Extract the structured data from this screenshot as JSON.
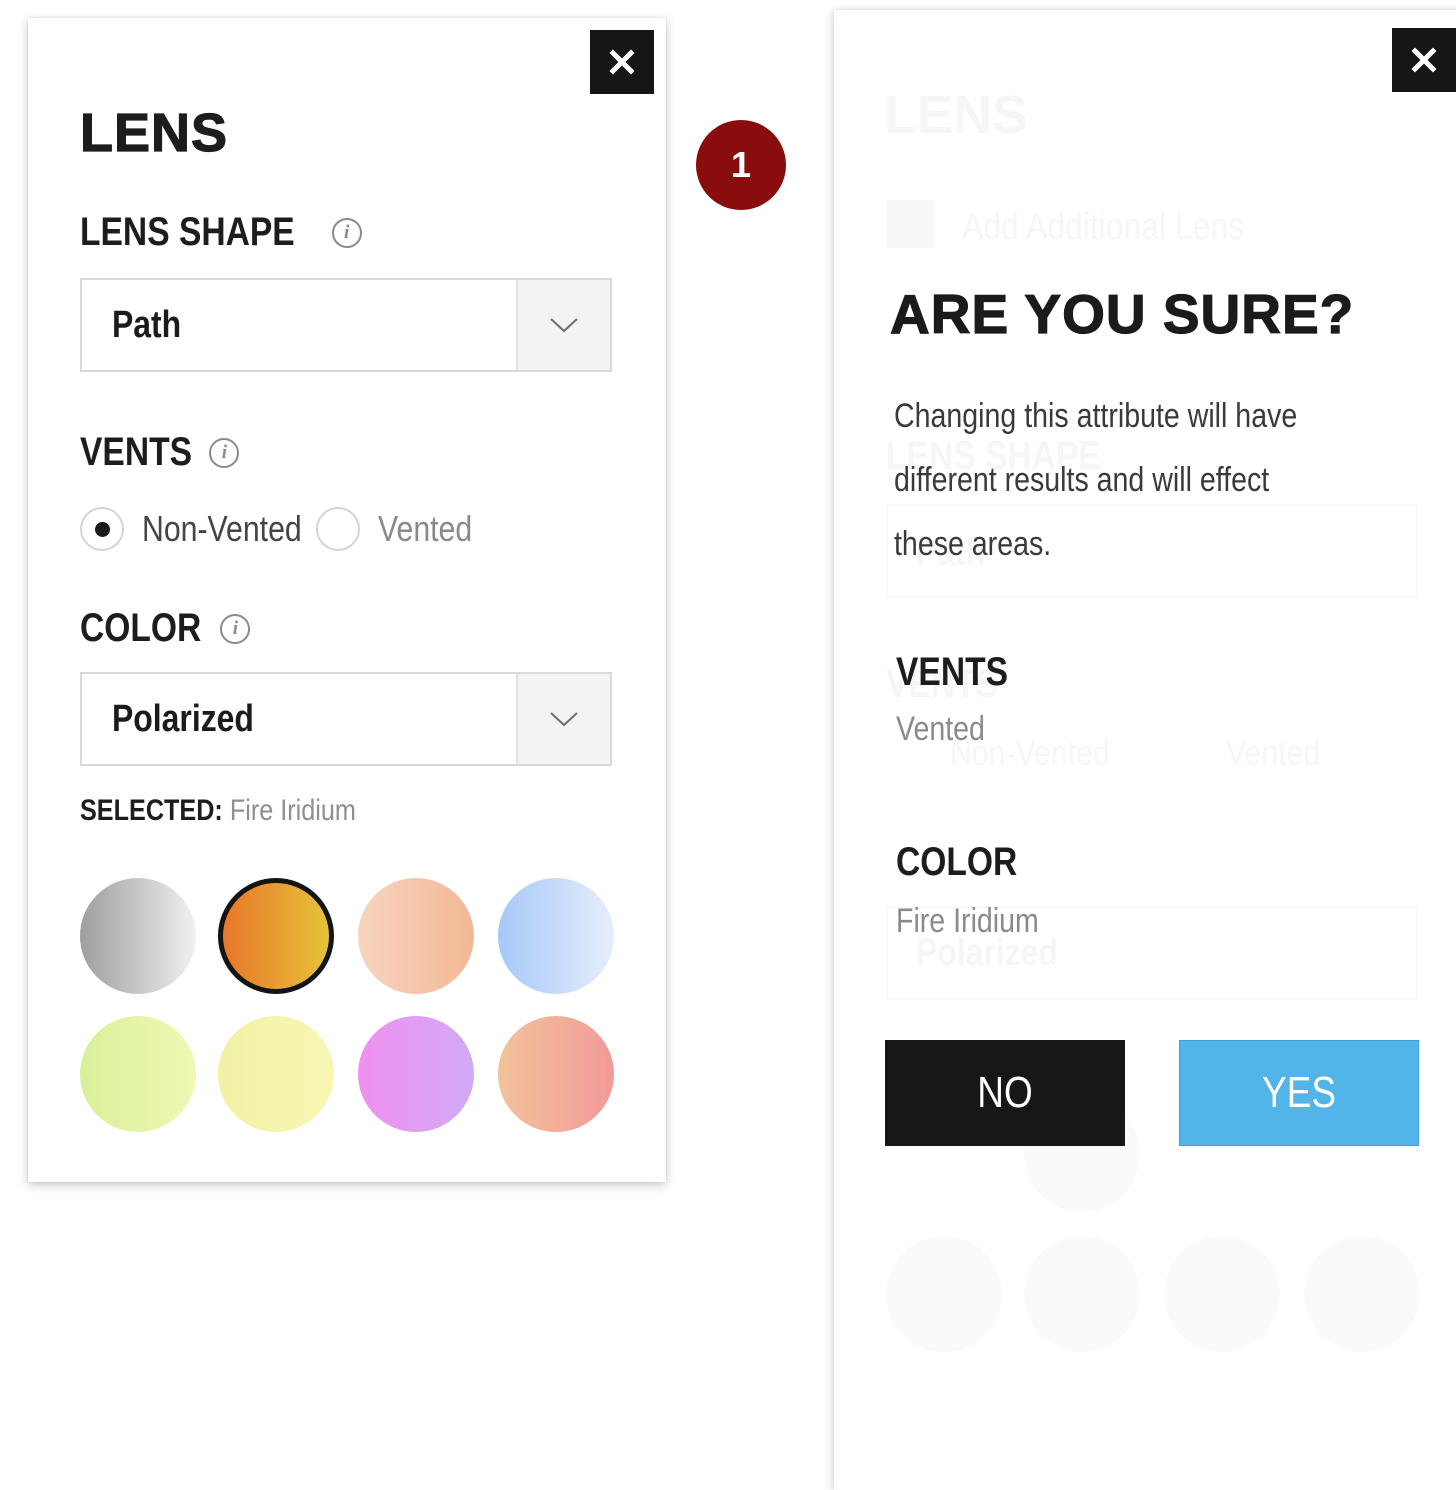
{
  "lens_panel": {
    "title": "LENS",
    "lens_shape": {
      "label": "LENS SHAPE",
      "info_glyph": "i",
      "selected_value": "Path"
    },
    "vents": {
      "label": "VENTS",
      "info_glyph": "i",
      "options": [
        {
          "label": "Non-Vented",
          "checked": true
        },
        {
          "label": "Vented",
          "checked": false
        }
      ]
    },
    "color": {
      "label": "COLOR",
      "info_glyph": "i",
      "selected_value": "Polarized"
    },
    "selected": {
      "key": "SELECTED:",
      "value": "Fire Iridium"
    },
    "swatches": [
      {
        "name": "silver",
        "from": "#9e9e9e",
        "to": "#f1f1f1",
        "active": false
      },
      {
        "name": "fire-iridium",
        "from": "#e8762a",
        "to": "#e6c33a",
        "active": true
      },
      {
        "name": "peach",
        "from": "#f7d4c0",
        "to": "#f3b895",
        "active": false
      },
      {
        "name": "blue",
        "from": "#a7c8f7",
        "to": "#e6eefc",
        "active": false
      },
      {
        "name": "lime",
        "from": "#d8f09a",
        "to": "#f1f8b4",
        "active": false
      },
      {
        "name": "yellow",
        "from": "#f1f2a6",
        "to": "#f8f6b4",
        "active": false
      },
      {
        "name": "violet",
        "from": "#f090ee",
        "to": "#d2aaf6",
        "active": false
      },
      {
        "name": "coral",
        "from": "#f2c39a",
        "to": "#f29a9a",
        "active": false
      }
    ]
  },
  "step_badge": "1",
  "confirm_panel": {
    "title": "ARE YOU SURE?",
    "message_lines": [
      "Changing this attribute will have",
      "different results and will effect",
      "these areas."
    ],
    "vents": {
      "label": "VENTS",
      "value": "Vented"
    },
    "color": {
      "label": "COLOR",
      "value": "Fire Iridium"
    },
    "no_label": "NO",
    "yes_label": "YES",
    "background_ghost": {
      "title": "LENS",
      "add_lens": "Add Additional Lens",
      "lens_shape": "LENS SHAPE",
      "shape_value": "Path",
      "vents": "VENTS",
      "non_vented": "Non-Vented",
      "vented": "Vented",
      "color_value": "Polarized"
    }
  },
  "colors": {
    "yes_button": "#52b4e9",
    "no_button": "#171717",
    "badge": "#8a0d0d"
  }
}
